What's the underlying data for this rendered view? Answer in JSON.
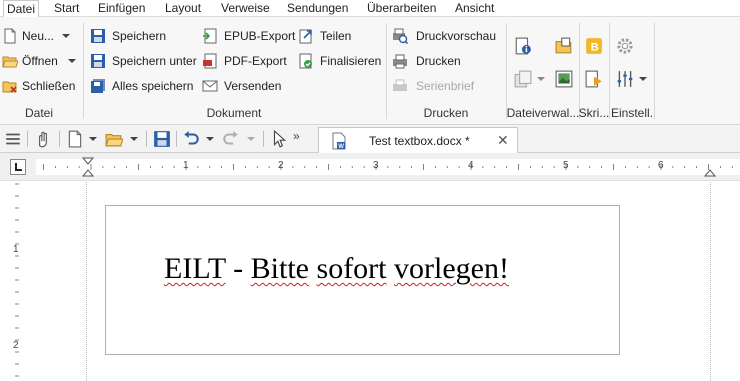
{
  "menu": [
    "Datei",
    "Start",
    "Einfügen",
    "Layout",
    "Verweise",
    "Sendungen",
    "Überarbeiten",
    "Ansicht"
  ],
  "ribbon": {
    "datei": {
      "new": "Neu...",
      "open": "Öffnen",
      "close": "Schließen",
      "group": "Datei"
    },
    "dokument": {
      "save": "Speichern",
      "save_as": "Speichern unter",
      "save_all": "Alles speichern",
      "epub": "EPUB-Export",
      "pdf": "PDF-Export",
      "send": "Versenden",
      "share": "Teilen",
      "finalize": "Finalisieren",
      "group": "Dokument"
    },
    "drucken": {
      "preview": "Druckvorschau",
      "print": "Drucken",
      "mailmerge": "Serienbrief",
      "group": "Drucken"
    },
    "dateiverw": {
      "group": "Dateiverwal..."
    },
    "skripte": {
      "group": "Skri..."
    },
    "einstell": {
      "group": "Einstell."
    }
  },
  "tab": {
    "title": "Test textbox.docx *",
    "close": "✕"
  },
  "ruler": {
    "h": [
      "1",
      "2",
      "3",
      "4",
      "5",
      "6"
    ],
    "v": [
      "1",
      "2"
    ]
  },
  "document": {
    "textbox_words": [
      "EILT",
      "-",
      "Bitte",
      "sofort",
      "vorlegen!"
    ]
  },
  "colors": {
    "accent": "#1e5aa8",
    "ribbon_bg": "#f7f7f7",
    "spell_error": "#d02020"
  }
}
